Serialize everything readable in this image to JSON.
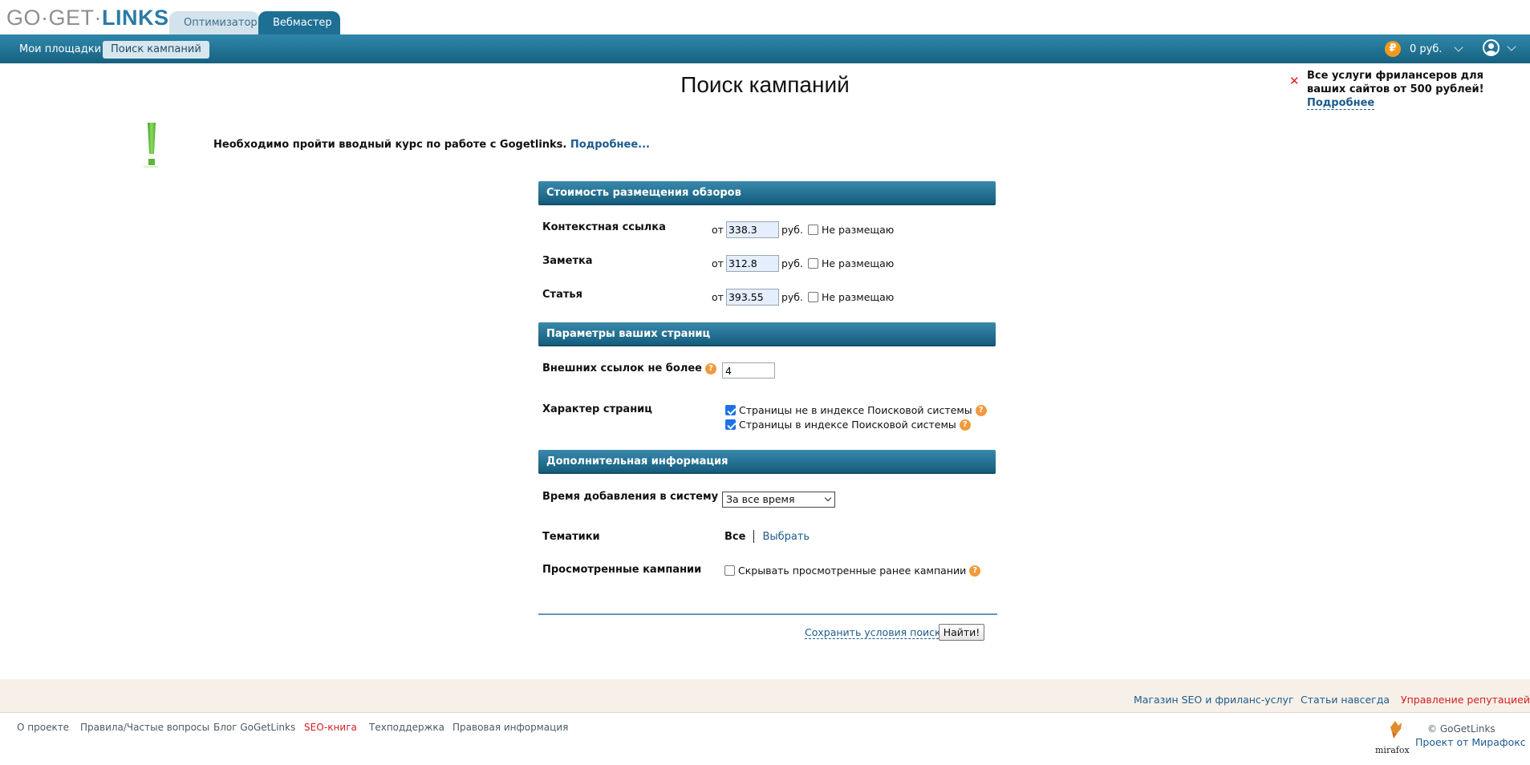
{
  "header": {
    "logo_part1": "GO·GET·",
    "logo_part2": "LINKS",
    "tabs": [
      {
        "label": "Оптимизатор",
        "active": false
      },
      {
        "label": "Вебмастер",
        "active": true
      }
    ],
    "nav": [
      {
        "label": "Мои площадки",
        "active": false
      },
      {
        "label": "Поиск кампаний",
        "active": true
      }
    ],
    "balance_icon": "₽",
    "balance": "0 руб."
  },
  "promo": {
    "text": "Все услуги фрилансеров для ваших сайтов от 500 рублей! ",
    "link": "Подробнее"
  },
  "page_title": "Поиск кампаний",
  "notice": {
    "text": "Необходимо пройти вводный курс по работе с Gogetlinks. ",
    "link": "Подробнее..."
  },
  "form": {
    "section_cost": {
      "title": "Стоимость размещения обзоров",
      "from_label": "от",
      "currency": "руб.",
      "no_place_label": "Не размещаю",
      "rows": [
        {
          "label": "Контекстная ссылка",
          "value": "338.3",
          "no_place": false
        },
        {
          "label": "Заметка",
          "value": "312.8",
          "no_place": false
        },
        {
          "label": "Статья",
          "value": "393.55",
          "no_place": false
        }
      ]
    },
    "section_pages": {
      "title": "Параметры ваших страниц",
      "external_links_label": "Внешних ссылок не более",
      "external_links_value": "4",
      "page_type_label": "Характер страниц",
      "page_types": [
        {
          "label": "Страницы не в индексе Поисковой системы",
          "checked": true
        },
        {
          "label": "Страницы в индексе Поисковой системы",
          "checked": true
        }
      ]
    },
    "section_extra": {
      "title": "Дополнительная информация",
      "period_label": "Время добавления в систему",
      "period_value": "За все время",
      "topics_label": "Тематики",
      "topics_all": "Все",
      "topics_choose": "Выбрать",
      "viewed_label": "Просмотренные кампании",
      "hide_viewed_label": "Скрывать просмотренные ранее кампании",
      "hide_viewed_checked": false
    },
    "help_glyph": "?",
    "save_label": "Сохранить условия поиска",
    "find_label": "Найти!"
  },
  "footer": {
    "top_links": [
      {
        "label": "Магазин SEO и фриланс-услуг"
      },
      {
        "label": "Статьи навсегда"
      },
      {
        "label": "Управление репутацией"
      }
    ],
    "bottom_links": [
      {
        "label": "О проекте"
      },
      {
        "label": "Правила/Частые вопросы"
      },
      {
        "label": "Блог GoGetLinks"
      },
      {
        "label": "SEO-книга"
      },
      {
        "label": "Техподдержка"
      },
      {
        "label": "Правовая информация"
      }
    ],
    "copyright": "© GoGetLinks",
    "project_link": "Проект от Мирафокс",
    "mirafox_label": "mirafox"
  },
  "colors": {
    "brand_blue": "#1d6f94",
    "nav_gradient_top": "#2f87ab",
    "help_orange": "#f19a3d",
    "alert_red": "#d31d1d",
    "coin_orange": "#f39a1c",
    "notice_green": "#6cc04a"
  },
  "icons": [
    "rouble-coin-icon",
    "user-avatar-icon",
    "chevron-down-icon",
    "close-icon",
    "exclamation-icon",
    "help-icon",
    "checkbox-icon",
    "mirafox-fox-logo"
  ]
}
